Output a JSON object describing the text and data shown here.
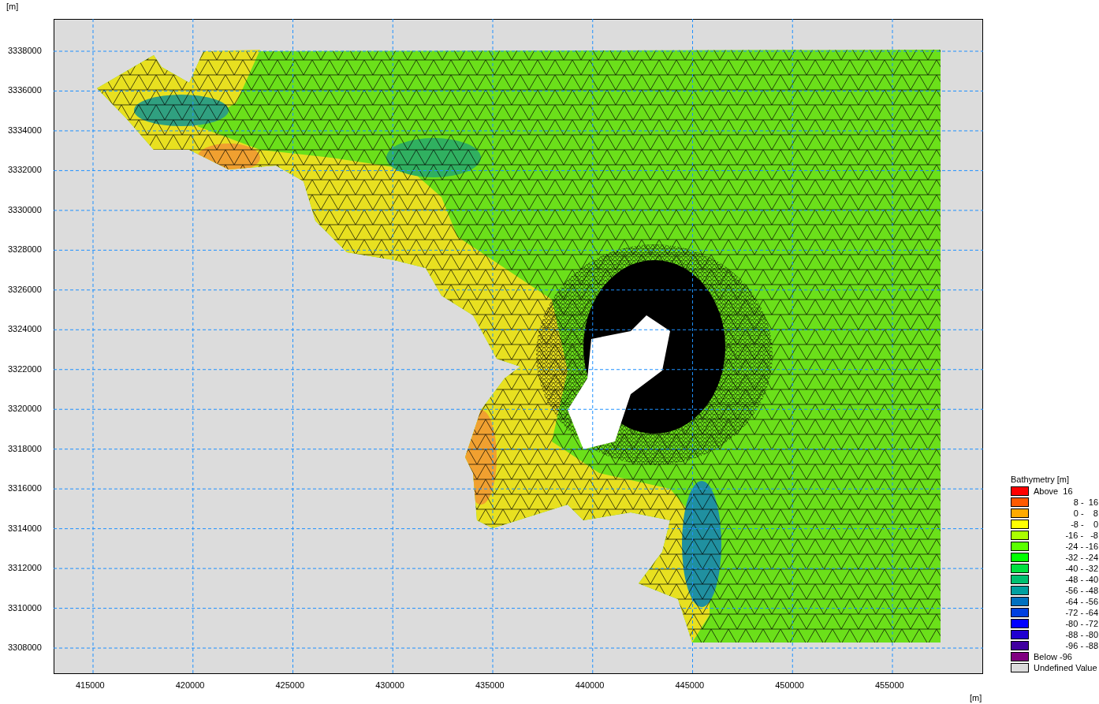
{
  "y_axis_unit": "[m]",
  "x_axis_unit": "[m]",
  "y_ticks": [
    "3338000",
    "3336000",
    "3334000",
    "3332000",
    "3330000",
    "3328000",
    "3326000",
    "3324000",
    "3322000",
    "3320000",
    "3318000",
    "3316000",
    "3314000",
    "3312000",
    "3310000",
    "3308000"
  ],
  "x_ticks": [
    "415000",
    "420000",
    "425000",
    "430000",
    "435000",
    "440000",
    "445000",
    "450000",
    "455000"
  ],
  "legend": {
    "title": "Bathymetry [m]",
    "items": [
      {
        "label": "Above  16",
        "color": "#ff0000"
      },
      {
        "label": "8 -  16",
        "color": "#ff5a00"
      },
      {
        "label": "0 -    8",
        "color": "#ffaa00"
      },
      {
        "label": "-8 -    0",
        "color": "#ffff00"
      },
      {
        "label": "-16 -   -8",
        "color": "#aaff00"
      },
      {
        "label": "-24 - -16",
        "color": "#5aff00"
      },
      {
        "label": "-32 - -24",
        "color": "#00ff00"
      },
      {
        "label": "-40 - -32",
        "color": "#00e040"
      },
      {
        "label": "-48 - -40",
        "color": "#00c070"
      },
      {
        "label": "-56 - -48",
        "color": "#00a0a0"
      },
      {
        "label": "-64 - -56",
        "color": "#0070c0"
      },
      {
        "label": "-72 - -64",
        "color": "#0040e0"
      },
      {
        "label": "-80 - -72",
        "color": "#0000ff"
      },
      {
        "label": "-88 - -80",
        "color": "#2000d0"
      },
      {
        "label": "-96 - -88",
        "color": "#4000a0"
      },
      {
        "label": "Below -96",
        "color": "#800080"
      },
      {
        "label": "Undefined Value",
        "color": "#dcdcdc"
      }
    ]
  }
}
